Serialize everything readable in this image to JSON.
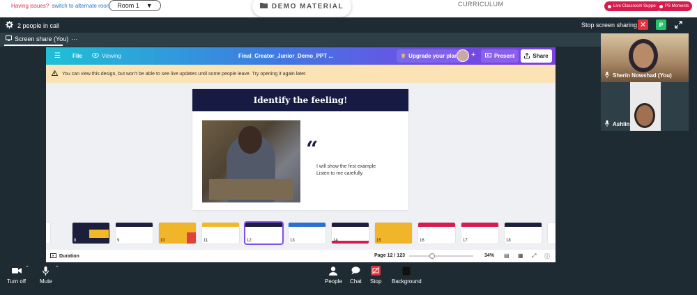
{
  "topbar": {
    "issues_text": "Having issues?",
    "alt_room_link": "switch to alternate room",
    "room_select": "Room 1",
    "demo_material": "DEMO MATERIAL",
    "curriculum": "CURRICULUM",
    "live_support": "Live Classroom Support",
    "ps_moments": "PS Moments"
  },
  "call": {
    "people_count": "2 people in call",
    "stop_screen_sharing": "Stop screen sharing",
    "p_badge": "P",
    "share_tab": "Screen share (You)",
    "share_tab_more": "···"
  },
  "canva": {
    "file": "File",
    "viewing": "Viewing",
    "doc_title": "Final_Creator_Junior_Demo_PPT ...",
    "upgrade": "Upgrade your plan",
    "present": "Present",
    "share": "Share",
    "warning": "You can view this design, but won't be able to see live updates until some people leave. Try opening it again later.",
    "slide_title": "Identify the feeling!",
    "slide_quote": "“",
    "slide_line1": "I will show the first example",
    "slide_line2": "Listen to me carefully.",
    "thumbnails": [
      "8",
      "9",
      "10",
      "11",
      "12",
      "13",
      "14",
      "15",
      "16",
      "17",
      "18"
    ],
    "active_thumbnail": "12",
    "duration": "Duration",
    "page": "Page 12 / 123",
    "zoom": "34%"
  },
  "participants": [
    {
      "name": "Sherin Nowshad (You)"
    },
    {
      "name": "Ashlin"
    }
  ],
  "controls": {
    "turn_off": "Turn off",
    "mute": "Mute",
    "people": "People",
    "chat": "Chat",
    "stop": "Stop",
    "background": "Background"
  },
  "colors": {
    "call_bg": "#1e2b33",
    "alert_red": "#d81b4c",
    "canva_purple": "#7d4fe8",
    "slide_navy": "#171b43"
  }
}
